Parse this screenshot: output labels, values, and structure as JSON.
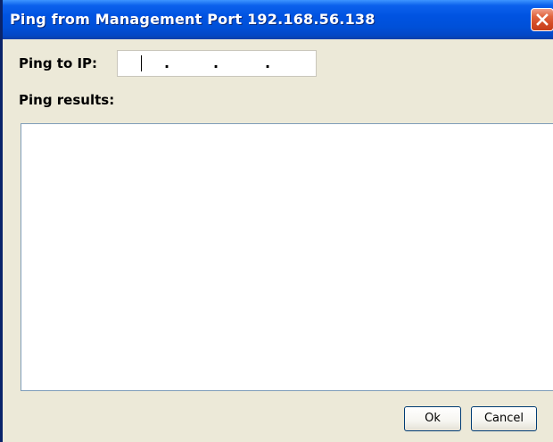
{
  "window": {
    "title": "Ping from Management Port 192.168.56.138"
  },
  "ping": {
    "ip_label": "Ping to IP:",
    "ip_value": "",
    "separator": "."
  },
  "results": {
    "label": "Ping results:",
    "text": ""
  },
  "buttons": {
    "ok_label": "Ok",
    "cancel_label": "Cancel"
  },
  "icons": {
    "close": "close-icon"
  }
}
